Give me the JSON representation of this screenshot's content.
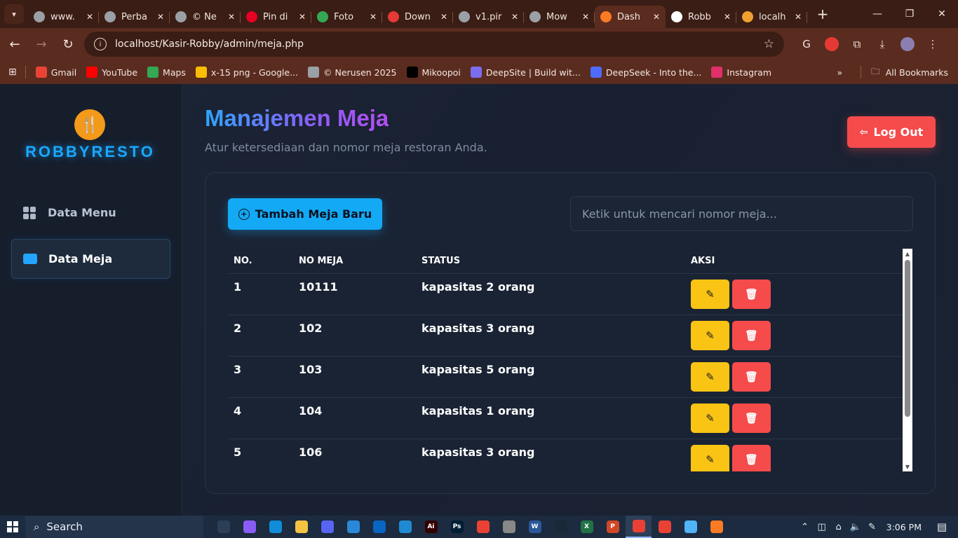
{
  "browser": {
    "tabs": [
      {
        "title": "www.",
        "icon": "globe-icon",
        "color": "#9aa0a6"
      },
      {
        "title": "Perba",
        "icon": "openai-icon",
        "color": "#9aa0a6"
      },
      {
        "title": "© Ne",
        "icon": "globe-icon",
        "color": "#9aa0a6"
      },
      {
        "title": "Pin di",
        "icon": "pinterest-icon",
        "color": "#e60023"
      },
      {
        "title": "Foto",
        "icon": "drive-icon",
        "color": "#34a853"
      },
      {
        "title": "Down",
        "icon": "download-icon",
        "color": "#e53935"
      },
      {
        "title": "v1.pir",
        "icon": "globe-icon",
        "color": "#9aa0a6"
      },
      {
        "title": "Mow",
        "icon": "app-icon",
        "color": "#9aa0a6"
      },
      {
        "title": "Dash",
        "icon": "xampp-icon",
        "color": "#fb7a24",
        "active": true
      },
      {
        "title": "Robb",
        "icon": "github-icon",
        "color": "#ffffff"
      },
      {
        "title": "localh",
        "icon": "phpmyadmin-icon",
        "color": "#f0a030"
      }
    ],
    "url": "localhost/Kasir-Robby/admin/meja.php",
    "bookmarks": [
      {
        "label": "Gmail",
        "icon": "gmail-icon",
        "color": "#ea4335"
      },
      {
        "label": "YouTube",
        "icon": "youtube-icon",
        "color": "#ff0000"
      },
      {
        "label": "Maps",
        "icon": "maps-icon",
        "color": "#34a853"
      },
      {
        "label": "x-15 png - Google...",
        "icon": "drive-icon",
        "color": "#fbbc04"
      },
      {
        "label": "© Nerusen 2025",
        "icon": "globe-icon",
        "color": "#9aa0a6"
      },
      {
        "label": "Mikoopoi",
        "icon": "triangle-icon",
        "color": "#000000"
      },
      {
        "label": "DeepSite | Build wit...",
        "icon": "deepsite-icon",
        "color": "#7c6cf0"
      },
      {
        "label": "DeepSeek - Into the...",
        "icon": "deepseek-icon",
        "color": "#4d6bfe"
      },
      {
        "label": "Instagram",
        "icon": "instagram-icon",
        "color": "#e1306c"
      }
    ],
    "all_bookmarks": "All Bookmarks"
  },
  "sidebar": {
    "brand": "ROBBYRESTO",
    "items": [
      {
        "label": "Data Menu",
        "icon": "grid-icon"
      },
      {
        "label": "Data Meja",
        "icon": "table-icon",
        "active": true
      }
    ]
  },
  "header": {
    "title": "Manajemen Meja",
    "subtitle": "Atur ketersediaan dan nomor meja restoran Anda.",
    "logout_label": "Log Out"
  },
  "toolbar": {
    "add_label": "Tambah Meja Baru",
    "search_placeholder": "Ketik untuk mencari nomor meja..."
  },
  "table": {
    "columns": [
      "NO.",
      "NO MEJA",
      "STATUS",
      "AKSI"
    ],
    "rows": [
      {
        "no": "1",
        "meja": "10111",
        "status": "kapasitas 2 orang"
      },
      {
        "no": "2",
        "meja": "102",
        "status": "kapasitas 3 orang"
      },
      {
        "no": "3",
        "meja": "103",
        "status": "kapasitas 5 orang"
      },
      {
        "no": "4",
        "meja": "104",
        "status": "kapasitas 1 orang"
      },
      {
        "no": "5",
        "meja": "106",
        "status": "kapasitas 3 orang"
      }
    ]
  },
  "taskbar": {
    "search_label": "Search",
    "time": "3:06 PM",
    "apps": [
      {
        "name": "task-view",
        "label": "",
        "color": "#2d3f57"
      },
      {
        "name": "copilot",
        "label": "",
        "color": "#8a5cf6"
      },
      {
        "name": "edge",
        "label": "",
        "color": "#0f8dd8"
      },
      {
        "name": "file-explorer",
        "label": "",
        "color": "#f5c342"
      },
      {
        "name": "discord",
        "label": "",
        "color": "#5865f2"
      },
      {
        "name": "store",
        "label": "",
        "color": "#2b88d8"
      },
      {
        "name": "outlook",
        "label": "",
        "color": "#0a64c2"
      },
      {
        "name": "vscode",
        "label": "",
        "color": "#1f8ad2"
      },
      {
        "name": "illustrator",
        "label": "Ai",
        "color": "#330000"
      },
      {
        "name": "photoshop",
        "label": "Ps",
        "color": "#001e36"
      },
      {
        "name": "chrome",
        "label": "",
        "color": "#e94235"
      },
      {
        "name": "app-swirl",
        "label": "",
        "color": "#888888"
      },
      {
        "name": "word",
        "label": "W",
        "color": "#2b579a"
      },
      {
        "name": "steam",
        "label": "",
        "color": "#1b2838"
      },
      {
        "name": "excel",
        "label": "X",
        "color": "#217346"
      },
      {
        "name": "powerpoint",
        "label": "P",
        "color": "#d24726"
      },
      {
        "name": "chrome-active",
        "label": "",
        "color": "#e94235",
        "active": true
      },
      {
        "name": "chrome-2",
        "label": "",
        "color": "#e94235"
      },
      {
        "name": "notepad",
        "label": "",
        "color": "#4fb3f6"
      },
      {
        "name": "xampp",
        "label": "",
        "color": "#fb7a24"
      }
    ]
  }
}
